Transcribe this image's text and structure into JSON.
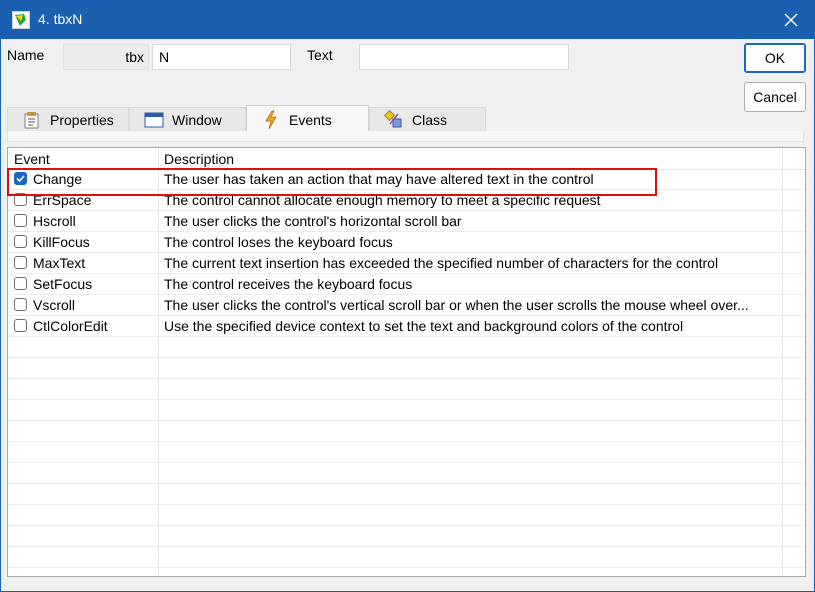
{
  "window": {
    "title": "4. tbxN"
  },
  "fields": {
    "name_label": "Name",
    "name_prefix": "tbx",
    "name_value": "N",
    "text_label": "Text",
    "text_value": ""
  },
  "buttons": {
    "ok": "OK",
    "cancel": "Cancel"
  },
  "tabs": [
    {
      "label": "Properties",
      "icon": "properties-icon"
    },
    {
      "label": "Window",
      "icon": "window-icon"
    },
    {
      "label": "Events",
      "icon": "lightning-icon",
      "active": true
    },
    {
      "label": "Class",
      "icon": "class-icon"
    }
  ],
  "grid": {
    "headers": {
      "event": "Event",
      "description": "Description"
    },
    "rows": [
      {
        "event": "Change",
        "description": "The user has taken an action that may have altered text in the control",
        "checked": true
      },
      {
        "event": "ErrSpace",
        "description": "The control cannot allocate enough memory to meet a specific request",
        "checked": false
      },
      {
        "event": "Hscroll",
        "description": "The user clicks the control's horizontal scroll bar",
        "checked": false
      },
      {
        "event": "KillFocus",
        "description": "The control loses the keyboard focus",
        "checked": false
      },
      {
        "event": "MaxText",
        "description": "The current text insertion has exceeded the specified number of characters for the control",
        "checked": false
      },
      {
        "event": "SetFocus",
        "description": "The control receives the keyboard focus",
        "checked": false
      },
      {
        "event": "Vscroll",
        "description": "The user clicks the control's vertical scroll bar or when the user scrolls the mouse wheel over...",
        "checked": false
      },
      {
        "event": "CtlColorEdit",
        "description": "Use the specified device context to set the text and background colors of the control",
        "checked": false
      }
    ]
  },
  "colors": {
    "titlebar": "#1b5fb0",
    "accent": "#1a66c2",
    "highlight": "#e30c0c"
  }
}
